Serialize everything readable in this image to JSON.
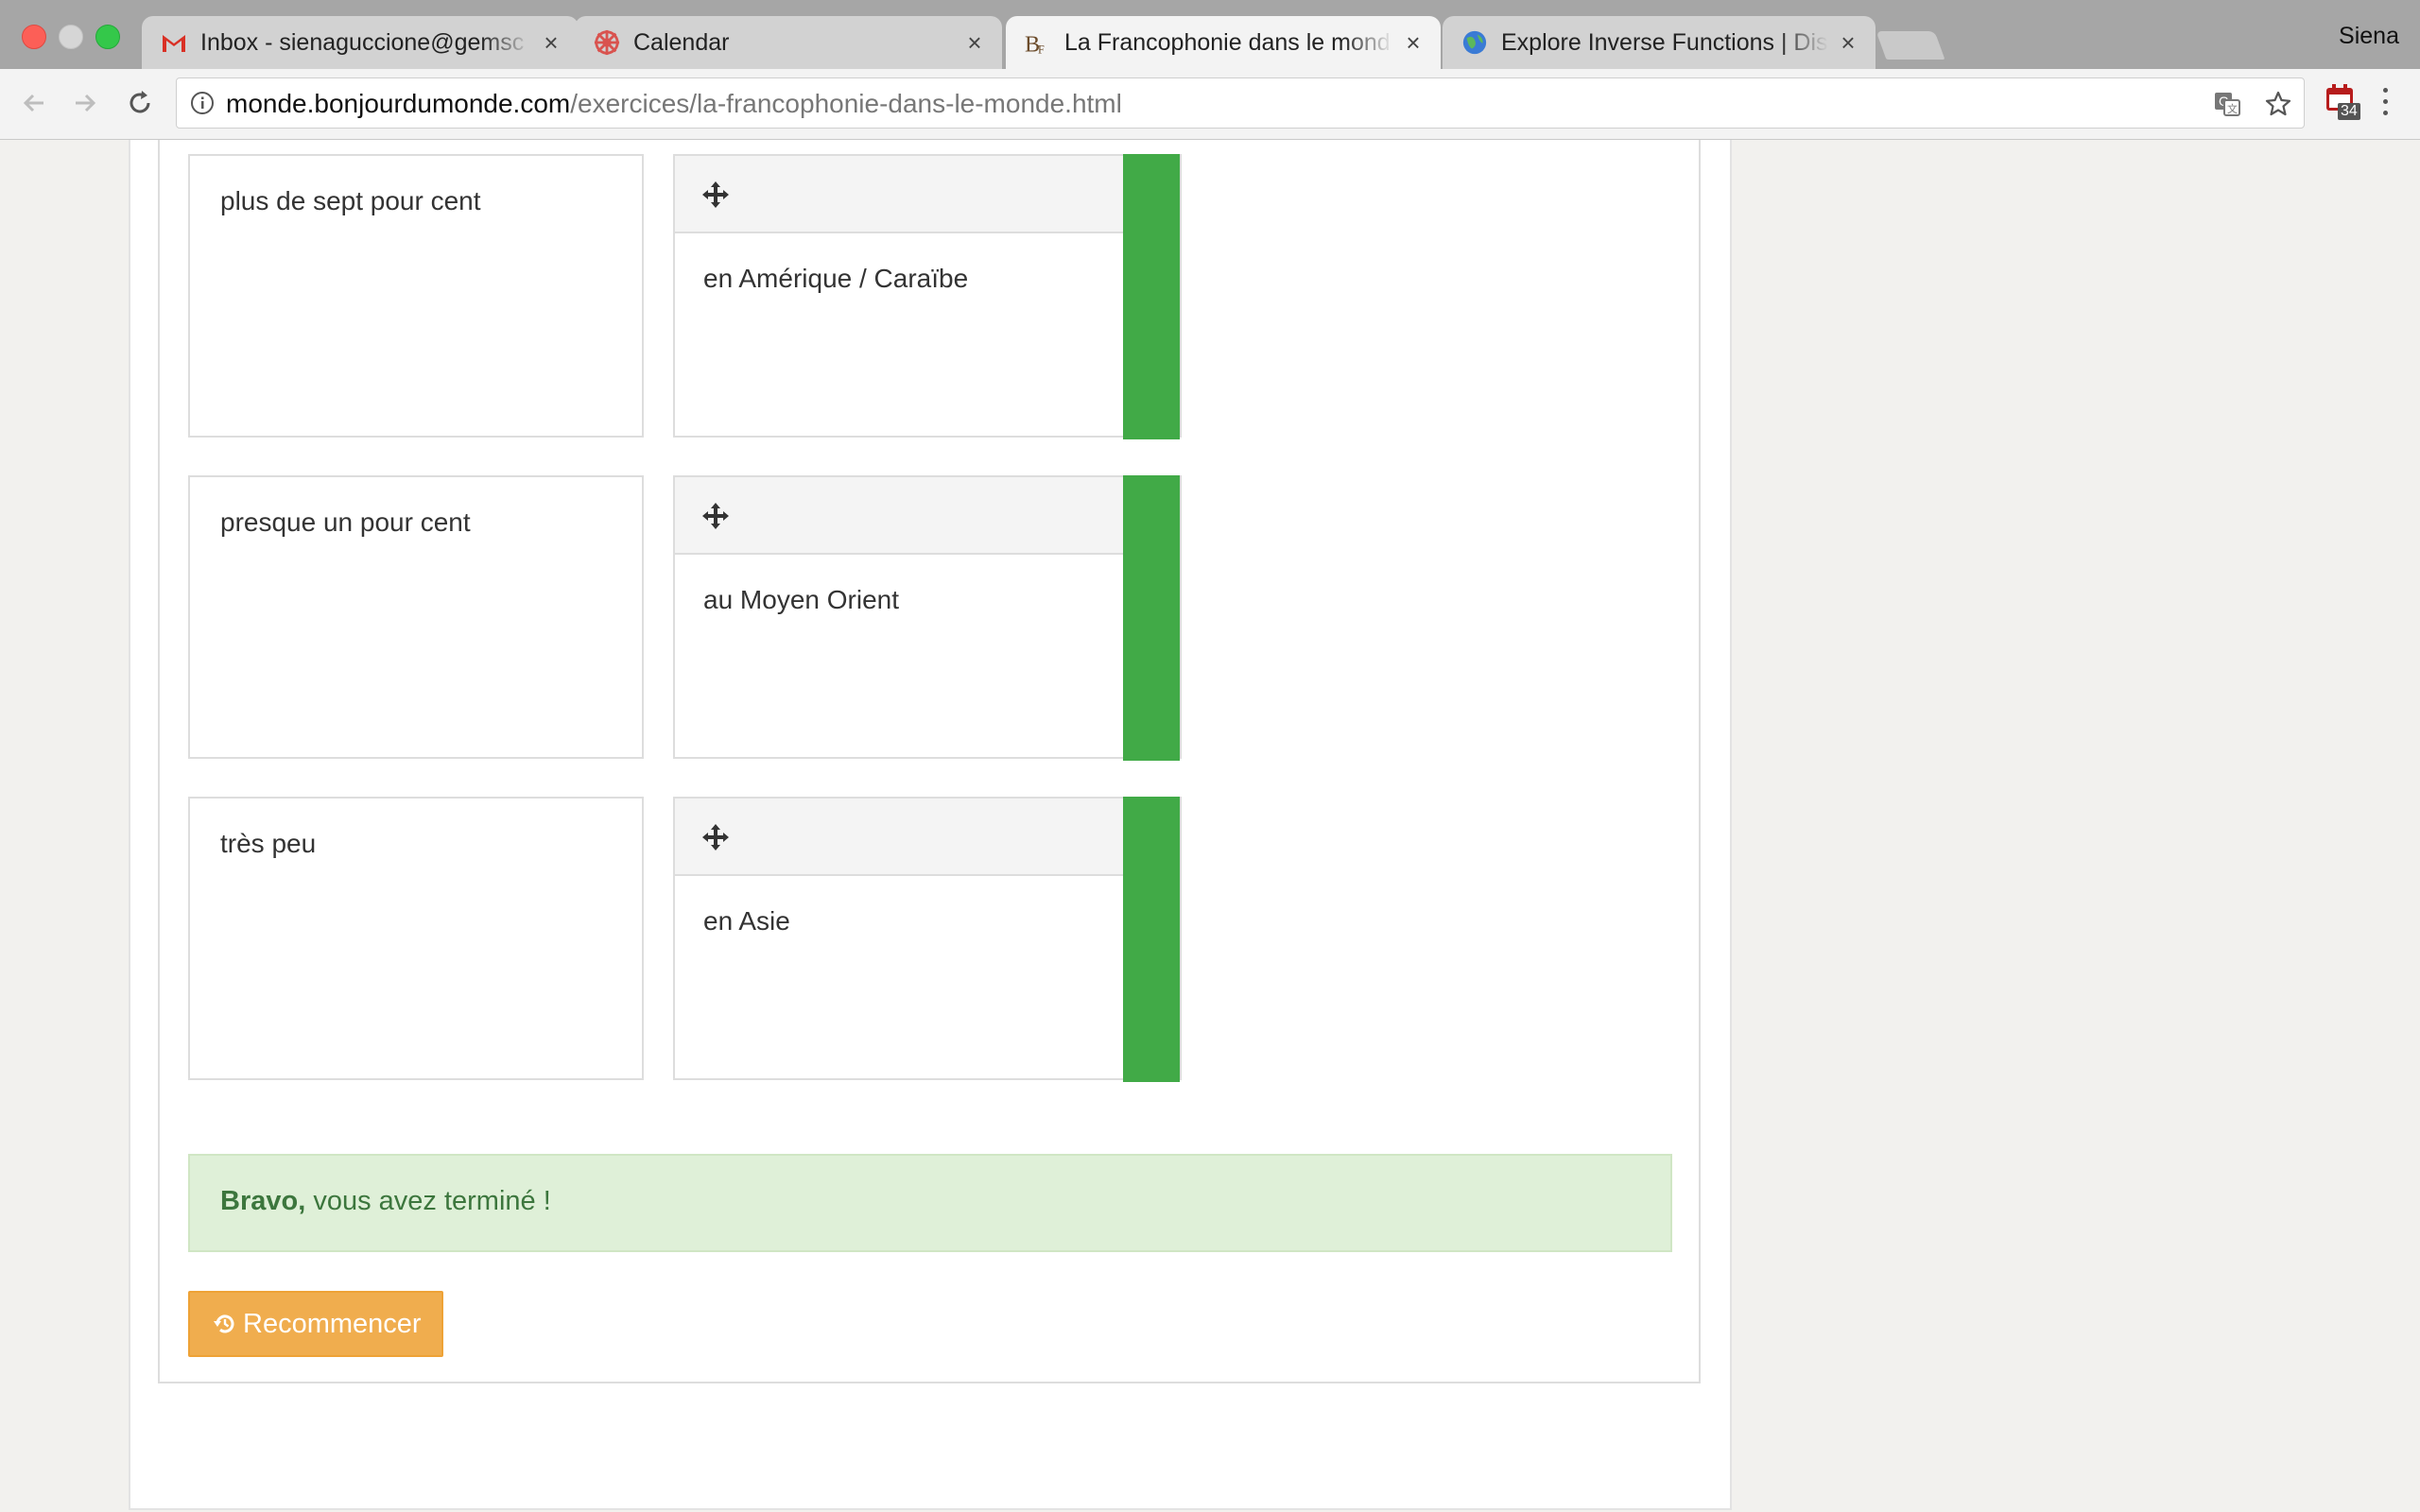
{
  "browser": {
    "profile_name": "Siena",
    "tabs": [
      {
        "title": "Inbox - sienaguccione@gemsc",
        "icon": "gmail-icon",
        "active": false
      },
      {
        "title": "Calendar",
        "icon": "calendar-icon",
        "active": false
      },
      {
        "title": "La Francophonie dans le mond",
        "icon": "bonjourdumonde-icon",
        "active": true
      },
      {
        "title": "Explore Inverse Functions | Dis",
        "icon": "globe-icon",
        "active": false
      }
    ],
    "url_host": "monde.bonjourdumonde.com",
    "url_path": "/exercices/la-francophonie-dans-le-monde.html",
    "extension_badge": "34"
  },
  "exercise": {
    "pairs": [
      {
        "prompt": "plus de sept pour cent",
        "answer": "en Amérique / Caraïbe",
        "status": "correct"
      },
      {
        "prompt": "presque un pour cent",
        "answer": "au Moyen Orient",
        "status": "correct"
      },
      {
        "prompt": "très peu",
        "answer": "en Asie",
        "status": "correct"
      }
    ],
    "result_bold": "Bravo,",
    "result_text": " vous avez terminé !",
    "restart_label": "Recommencer"
  },
  "colors": {
    "correct": "#41aa47",
    "alert_bg": "#dff0d8",
    "alert_text": "#3c763d",
    "restart_button": "#f0ad4e"
  }
}
